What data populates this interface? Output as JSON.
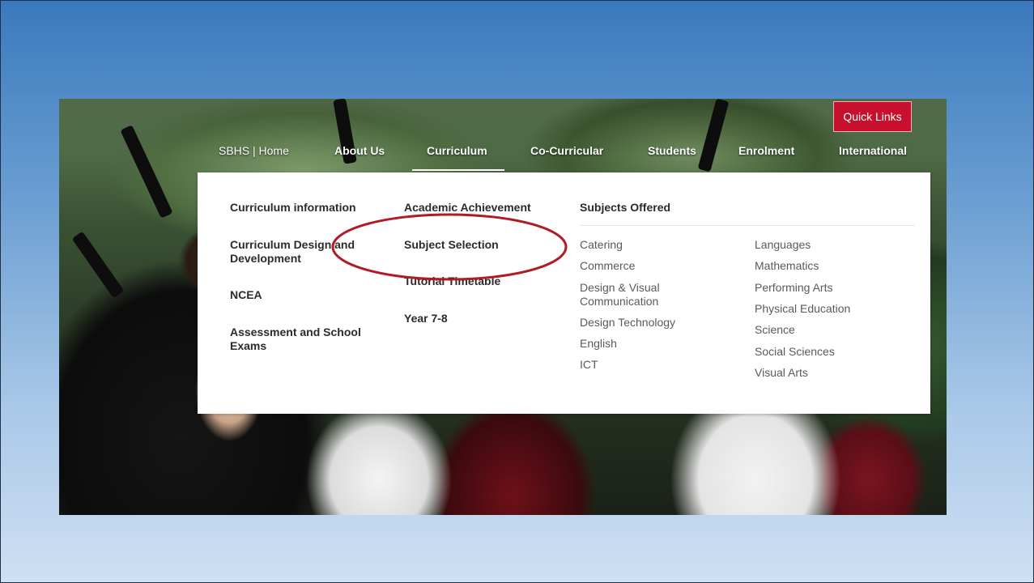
{
  "colors": {
    "quick_links_bg": "#c8102e",
    "annotation": "#b01b24",
    "menu_bg": "#ffffff"
  },
  "quick_links": {
    "label": "Quick Links"
  },
  "nav": {
    "items": [
      {
        "label": "SBHS | Home"
      },
      {
        "label": "About Us"
      },
      {
        "label": "Curriculum"
      },
      {
        "label": "Co-Curricular"
      },
      {
        "label": "Students"
      },
      {
        "label": "Enrolment"
      },
      {
        "label": "International"
      }
    ],
    "active": "Curriculum"
  },
  "menu": {
    "col1": [
      {
        "label": "Curriculum information"
      },
      {
        "label": "Curriculum Design and Development"
      },
      {
        "label": "NCEA"
      },
      {
        "label": "Assessment and School Exams"
      }
    ],
    "col2": [
      {
        "label": "Academic Achievement"
      },
      {
        "label": "Subject Selection"
      },
      {
        "label": "Tutorial Timetable"
      },
      {
        "label": "Year 7-8"
      }
    ],
    "subjects_heading": "Subjects Offered",
    "subjects_left": [
      {
        "label": "Catering"
      },
      {
        "label": "Commerce"
      },
      {
        "label": "Design & Visual Communication"
      },
      {
        "label": "Design Technology"
      },
      {
        "label": "English"
      },
      {
        "label": "ICT"
      }
    ],
    "subjects_right": [
      {
        "label": "Languages"
      },
      {
        "label": "Mathematics"
      },
      {
        "label": "Performing Arts"
      },
      {
        "label": "Physical Education"
      },
      {
        "label": "Science"
      },
      {
        "label": "Social Sciences"
      },
      {
        "label": "Visual Arts"
      }
    ]
  }
}
